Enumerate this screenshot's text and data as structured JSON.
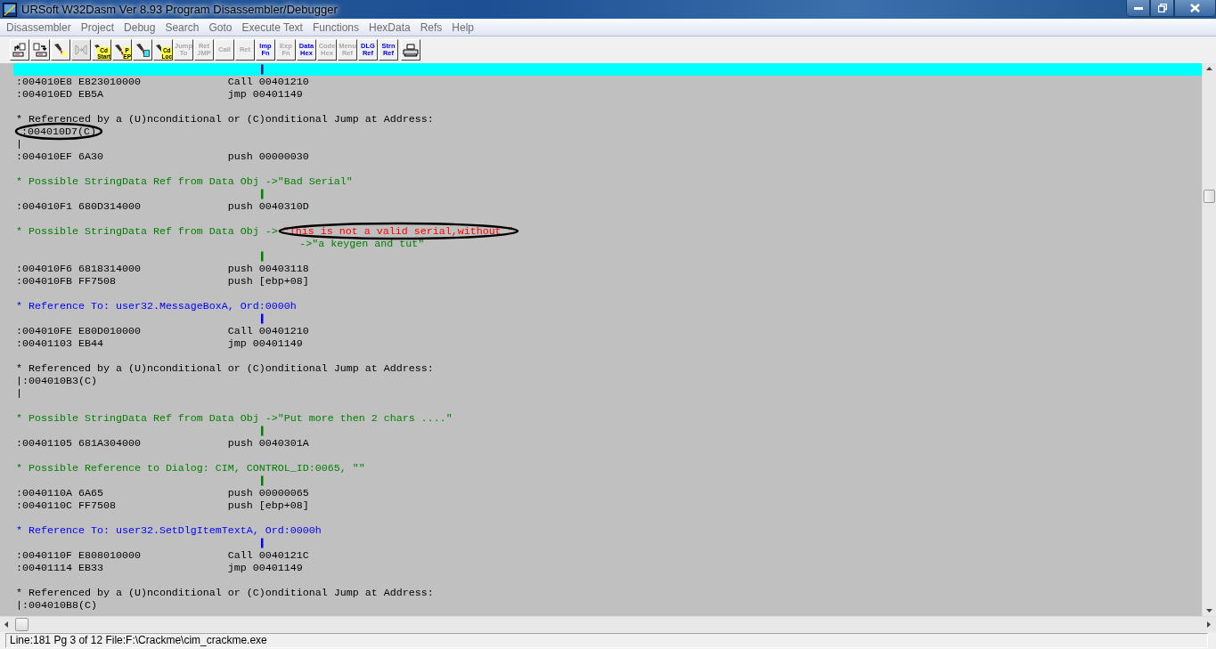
{
  "window": {
    "title": "URSoft W32Dasm Ver 8.93 Program Disassembler/Debugger"
  },
  "menu": [
    "Disassembler",
    "Project",
    "Debug",
    "Search",
    "Goto",
    "Execute Text",
    "Functions",
    "HexData",
    "Refs",
    "Help"
  ],
  "toolbar": [
    {
      "kind": "open",
      "disabled": false
    },
    {
      "kind": "save",
      "disabled": false
    },
    {
      "kind": "torch",
      "disabled": false
    },
    {
      "kind": "arrows",
      "disabled": true
    },
    {
      "kind": "torch",
      "label": [
        "Cd",
        "Start"
      ],
      "disabled": false
    },
    {
      "kind": "torch",
      "label": [
        "P",
        "EP"
      ],
      "disabled": false
    },
    {
      "kind": "torch-doc",
      "disabled": false
    },
    {
      "kind": "torch",
      "label": [
        "Cd",
        "Loc"
      ],
      "disabled": false
    },
    {
      "kind": "label",
      "label": [
        "Jump",
        "To"
      ],
      "disabled": true
    },
    {
      "kind": "label",
      "label": [
        "Ret",
        "JMP"
      ],
      "disabled": true
    },
    {
      "kind": "label",
      "label": [
        "Call"
      ],
      "disabled": true
    },
    {
      "kind": "label",
      "label": [
        "Ret"
      ],
      "disabled": true
    },
    {
      "kind": "label",
      "label": [
        "Imp",
        "Fn"
      ],
      "disabled": false
    },
    {
      "kind": "label",
      "label": [
        "Exp",
        "Fn"
      ],
      "disabled": true
    },
    {
      "kind": "label",
      "label": [
        "Data",
        "Hex"
      ],
      "disabled": false
    },
    {
      "kind": "label",
      "label": [
        "Code",
        "Hex"
      ],
      "disabled": true
    },
    {
      "kind": "label",
      "label": [
        "Menu",
        "Ref"
      ],
      "disabled": true
    },
    {
      "kind": "label",
      "label": [
        "DLG",
        "Ref"
      ],
      "disabled": false
    },
    {
      "kind": "label",
      "label": [
        "Strn",
        "Ref"
      ],
      "disabled": false
    },
    {
      "kind": "printer",
      "disabled": false
    }
  ],
  "listing": [
    {
      "kind": "flow",
      "text": "|",
      "selected": true
    },
    {
      "kind": "code",
      "address": ":004010E8",
      "bytes": "E823010000",
      "instruction": "Call 00401210",
      "selected": false
    },
    {
      "kind": "code",
      "address": ":004010ED",
      "bytes": "EB5A",
      "instruction": "jmp 00401149",
      "selected": false
    },
    {
      "kind": "blank",
      "selected": false
    },
    {
      "kind": "comment",
      "text": "* Referenced by a (U)nconditional or (C)onditional Jump at Address:",
      "color": "#000000",
      "selected": false
    },
    {
      "kind": "xref",
      "text": ":004010D7(C)",
      "circled": true,
      "selected": false
    },
    {
      "kind": "xref",
      "text": "|",
      "circled": false,
      "selected": false
    },
    {
      "kind": "code",
      "address": ":004010EF",
      "bytes": "6A30",
      "instruction": "push 00000030",
      "selected": false
    },
    {
      "kind": "blank",
      "selected": false
    },
    {
      "kind": "comment",
      "text": "* Possible StringData Ref from Data Obj ->\"Bad Serial\"",
      "color": "#008000",
      "selected": false
    },
    {
      "kind": "flow",
      "text": "|",
      "color": "#008000",
      "selected": false
    },
    {
      "kind": "code",
      "address": ":004010F1",
      "bytes": "680D314000",
      "instruction": "push 0040310D",
      "selected": false
    },
    {
      "kind": "blank",
      "selected": false
    },
    {
      "kind": "comment",
      "text": "* Possible StringData Ref from Data Obj ->",
      "color": "#008000",
      "quote": {
        "text": "\"This is not a valid serial,without \"",
        "color": "#ff0000",
        "circled": true
      },
      "selected": false
    },
    {
      "kind": "continuation",
      "text": "->\"a keygen and tut\"",
      "color": "#008000",
      "selected": false
    },
    {
      "kind": "flow",
      "text": "|",
      "color": "#008000",
      "selected": false
    },
    {
      "kind": "code",
      "address": ":004010F6",
      "bytes": "6818314000",
      "instruction": "push 00403118",
      "selected": false
    },
    {
      "kind": "code",
      "address": ":004010FB",
      "bytes": "FF7508",
      "instruction": "push [ebp+08]",
      "selected": false
    },
    {
      "kind": "blank",
      "selected": false
    },
    {
      "kind": "comment",
      "text": "* Reference To: user32.MessageBoxA, Ord:0000h",
      "color": "#0000ff",
      "selected": false
    },
    {
      "kind": "flow",
      "text": "|",
      "color": "#0000ff",
      "selected": false
    },
    {
      "kind": "code",
      "address": ":004010FE",
      "bytes": "E80D010000",
      "instruction": "Call 00401210",
      "selected": false
    },
    {
      "kind": "code",
      "address": ":00401103",
      "bytes": "EB44",
      "instruction": "jmp 00401149",
      "selected": false
    },
    {
      "kind": "blank",
      "selected": false
    },
    {
      "kind": "comment",
      "text": "* Referenced by a (U)nconditional or (C)onditional Jump at Address:",
      "color": "#000000",
      "selected": false
    },
    {
      "kind": "xref",
      "text": "|:004010B3(C)",
      "circled": false,
      "selected": false
    },
    {
      "kind": "xref",
      "text": "|",
      "circled": false,
      "selected": false
    },
    {
      "kind": "blank",
      "selected": false
    },
    {
      "kind": "comment",
      "text": "* Possible StringData Ref from Data Obj ->\"Put more then 2 chars ....\"",
      "color": "#008000",
      "selected": false
    },
    {
      "kind": "flow",
      "text": "|",
      "color": "#008000",
      "selected": false
    },
    {
      "kind": "code",
      "address": ":00401105",
      "bytes": "681A304000",
      "instruction": "push 0040301A",
      "selected": false
    },
    {
      "kind": "blank",
      "selected": false
    },
    {
      "kind": "comment",
      "text": "* Possible Reference to Dialog: CIM, CONTROL_ID:0065, \"\"",
      "color": "#008000",
      "selected": false
    },
    {
      "kind": "flow",
      "text": "|",
      "color": "#008000",
      "selected": false
    },
    {
      "kind": "code",
      "address": ":0040110A",
      "bytes": "6A65",
      "instruction": "push 00000065",
      "selected": false
    },
    {
      "kind": "code",
      "address": ":0040110C",
      "bytes": "FF7508",
      "instruction": "push [ebp+08]",
      "selected": false
    },
    {
      "kind": "blank",
      "selected": false
    },
    {
      "kind": "comment",
      "text": "* Reference To: user32.SetDlgItemTextA, Ord:0000h",
      "color": "#0000ff",
      "selected": false
    },
    {
      "kind": "flow",
      "text": "|",
      "color": "#0000ff",
      "selected": false
    },
    {
      "kind": "code",
      "address": ":0040110F",
      "bytes": "E808010000",
      "instruction": "Call 0040121C",
      "selected": false
    },
    {
      "kind": "code",
      "address": ":00401114",
      "bytes": "EB33",
      "instruction": "jmp 00401149",
      "selected": false
    },
    {
      "kind": "blank",
      "selected": false
    },
    {
      "kind": "comment",
      "text": "* Referenced by a (U)nconditional or (C)onditional Jump at Address:",
      "color": "#000000",
      "selected": false
    },
    {
      "kind": "xref",
      "text": "|:004010B8(C)",
      "circled": false,
      "selected": false
    }
  ],
  "status_bar": "Line:181 Pg 3 of 12  File:F:\\Crackme\\cim_crackme.exe"
}
